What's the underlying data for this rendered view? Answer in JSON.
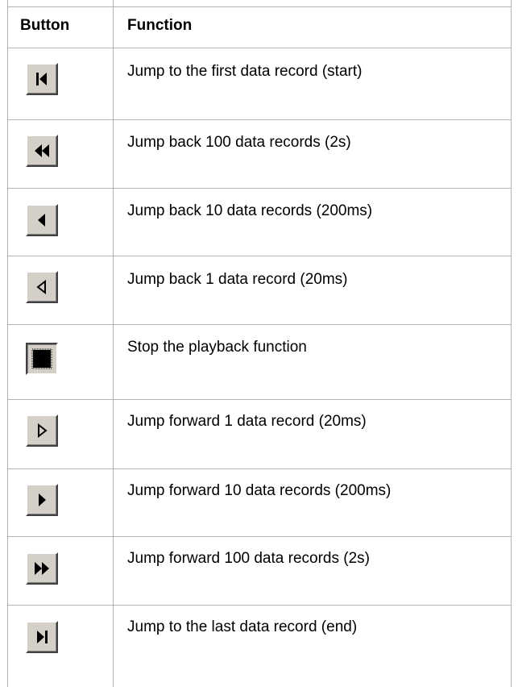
{
  "table": {
    "headers": {
      "button": "Button",
      "function": "Function"
    },
    "rows": [
      {
        "icon": "jump-to-start-icon",
        "function": "Jump to the first data record (start)"
      },
      {
        "icon": "fast-rewind-icon",
        "function": "Jump back 100 data records (2s)"
      },
      {
        "icon": "rewind-icon",
        "function": "Jump back 10 data records (200ms)"
      },
      {
        "icon": "step-back-icon",
        "function": "Jump back 1 data record (20ms)"
      },
      {
        "icon": "stop-icon",
        "function": "Stop the playback function"
      },
      {
        "icon": "step-forward-icon",
        "function": "Jump forward 1 data record (20ms)"
      },
      {
        "icon": "forward-icon",
        "function": "Jump forward 10 data records (200ms)"
      },
      {
        "icon": "fast-forward-icon",
        "function": "Jump forward 100 data records (2s)"
      },
      {
        "icon": "jump-to-end-icon",
        "function": "Jump to the last data record (end)"
      }
    ]
  }
}
